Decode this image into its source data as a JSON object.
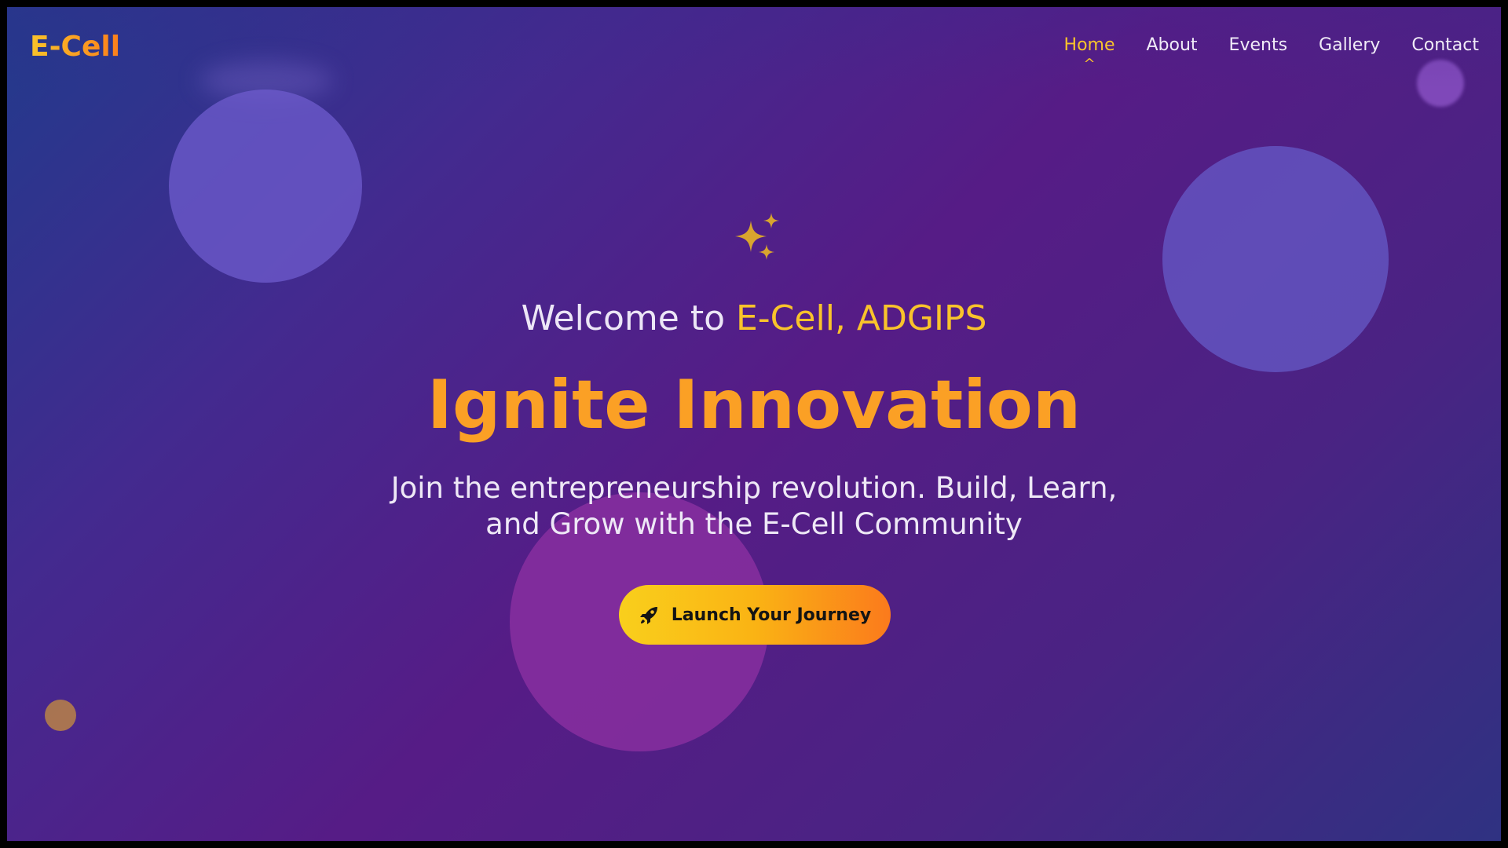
{
  "brand": {
    "logo": "E-Cell"
  },
  "nav": {
    "items": [
      {
        "label": "Home",
        "active": true
      },
      {
        "label": "About"
      },
      {
        "label": "Events"
      },
      {
        "label": "Gallery"
      },
      {
        "label": "Contact"
      }
    ],
    "active_indicator": "^"
  },
  "hero": {
    "icon": "sparkles-icon",
    "welcome_prefix": "Welcome to ",
    "welcome_accent": "E-Cell, ADGIPS",
    "headline": "Ignite Innovation",
    "subtitle": "Join the entrepreneurship revolution. Build, Learn, and Grow with the E-Cell Community",
    "cta": {
      "label": "Launch Your Journey",
      "icon": "rocket-icon"
    }
  },
  "colors": {
    "accent_gold": "#f9c32b",
    "accent_orange": "#fb7a1c",
    "nav_text": "#f1ecf8",
    "background_start": "#223a8c",
    "background_mid": "#561c86"
  }
}
